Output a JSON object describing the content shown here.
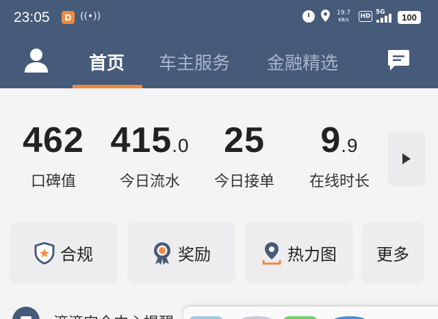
{
  "status_bar": {
    "time": "23:05",
    "app_badge": "D",
    "net_speed_value": "19.7",
    "net_speed_unit": "KB/s",
    "hd": "HD",
    "network": "5G",
    "battery": "100"
  },
  "nav": {
    "tabs": [
      {
        "label": "首页",
        "active": true
      },
      {
        "label": "车主服务",
        "active": false
      },
      {
        "label": "金融精选",
        "active": false
      }
    ]
  },
  "stats": [
    {
      "value": "462",
      "decimal": "",
      "label": "口碑值"
    },
    {
      "value": "415",
      "decimal": ".0",
      "label": "今日流水"
    },
    {
      "value": "25",
      "decimal": "",
      "label": "今日接单"
    },
    {
      "value": "9",
      "decimal": ".9",
      "label": "在线时长"
    }
  ],
  "actions": [
    {
      "label": "合规",
      "icon": "shield-icon"
    },
    {
      "label": "奖励",
      "icon": "medal-icon"
    },
    {
      "label": "热力图",
      "icon": "map-pin-icon"
    },
    {
      "label": "更多",
      "icon": ""
    }
  ],
  "bottom": {
    "text": "滴滴安全中心提醒"
  },
  "colors": {
    "header_bg": "#465a7a",
    "accent": "#f3883b",
    "page_bg": "#f4f4f5",
    "card_bg": "#ededef"
  }
}
